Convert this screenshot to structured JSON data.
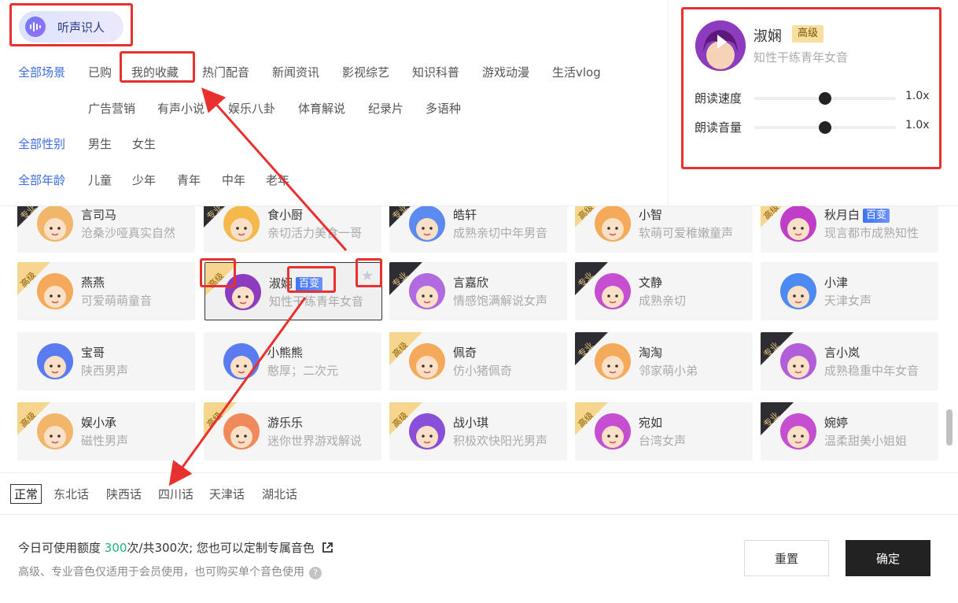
{
  "listen_button": {
    "label": "听声识人"
  },
  "filters": {
    "scene": {
      "all": "全部场景",
      "items": [
        "已购",
        "我的收藏",
        "热门配音",
        "新闻资讯",
        "影视综艺",
        "知识科普",
        "游戏动漫",
        "生活vlog",
        "广告营销",
        "有声小说",
        "娱乐八卦",
        "体育解说",
        "纪录片",
        "多语种"
      ]
    },
    "gender": {
      "all": "全部性别",
      "items": [
        "男生",
        "女生"
      ]
    },
    "age": {
      "all": "全部年龄",
      "items": [
        "儿童",
        "少年",
        "青年",
        "中年",
        "老年"
      ]
    }
  },
  "preview": {
    "name": "淑娴",
    "badge": "高级",
    "desc": "知性干练青年女音",
    "speed": {
      "label": "朗读速度",
      "value": "1.0x",
      "level": 0.5
    },
    "volume": {
      "label": "朗读音量",
      "value": "1.0x",
      "level": 0.5
    }
  },
  "voices": [
    {
      "name": "言司马",
      "desc": "沧桑沙哑真实自然",
      "ribbon": "专业",
      "face": "#f2b66b"
    },
    {
      "name": "食小厨",
      "desc": "亲切活力美食一哥",
      "ribbon": "专业",
      "face": "#f4b94a"
    },
    {
      "name": "皓轩",
      "desc": "成熟亲切中年男音",
      "ribbon": "专业",
      "face": "#5c8af0"
    },
    {
      "name": "小智",
      "desc": "软萌可爱稚嫩童声",
      "ribbon": "高级",
      "face": "#f5a95b"
    },
    {
      "name": "秋月白",
      "desc": "现言都市成熟知性",
      "ribbon": "高级",
      "face": "#c03ec7",
      "tag": "百变"
    },
    {
      "name": "燕燕",
      "desc": "可爱萌萌童音",
      "ribbon": "高级",
      "face": "#f5a95b"
    },
    {
      "name": "淑娴",
      "desc": "知性干练青年女音",
      "ribbon": "高级",
      "face": "#8e3cbf",
      "tag": "百变",
      "selected": true
    },
    {
      "name": "言嘉欣",
      "desc": "情感饱满解说女声",
      "ribbon": "专业",
      "face": "#b16adf"
    },
    {
      "name": "文静",
      "desc": "成熟亲切",
      "ribbon": "专业",
      "face": "#c54fd0"
    },
    {
      "name": "小津",
      "desc": "天津女声",
      "ribbon": "",
      "face": "#4d8bf2"
    },
    {
      "name": "宝哥",
      "desc": "陕西男声",
      "ribbon": "",
      "face": "#5b7cf0"
    },
    {
      "name": "小熊熊",
      "desc": "憨厚；二次元",
      "ribbon": "",
      "face": "#5b7cf0"
    },
    {
      "name": "佩奇",
      "desc": "仿小猪佩奇",
      "ribbon": "高级",
      "face": "#f5a95b"
    },
    {
      "name": "淘淘",
      "desc": "邻家萌小弟",
      "ribbon": "专业",
      "face": "#f5a95b"
    },
    {
      "name": "言小岚",
      "desc": "成熟稳重中年女音",
      "ribbon": "专业",
      "face": "#b15fd9"
    },
    {
      "name": "娱小承",
      "desc": "磁性男声",
      "ribbon": "高级",
      "face": "#f2b66b"
    },
    {
      "name": "游乐乐",
      "desc": "迷你世界游戏解说",
      "ribbon": "高级",
      "face": "#f08a5b"
    },
    {
      "name": "战小琪",
      "desc": "积极欢快阳光男声",
      "ribbon": "高级",
      "face": "#8a4fd9"
    },
    {
      "name": "宛如",
      "desc": "台湾女声",
      "ribbon": "高级",
      "face": "#c54fd0"
    },
    {
      "name": "婉婷",
      "desc": "温柔甜美小姐姐",
      "ribbon": "专业",
      "face": "#c54fd0"
    }
  ],
  "dialects": [
    "正常",
    "东北话",
    "陕西话",
    "四川话",
    "天津话",
    "湖北话"
  ],
  "footer": {
    "quota_prefix": "今日可使用额度 ",
    "quota_used": "300",
    "quota_suffix": "次/共300次;  您也可以定制专属音色",
    "note": "高级、专业音色仅适用于会员使用，也可购买单个音色使用",
    "reset": "重置",
    "confirm": "确定"
  }
}
